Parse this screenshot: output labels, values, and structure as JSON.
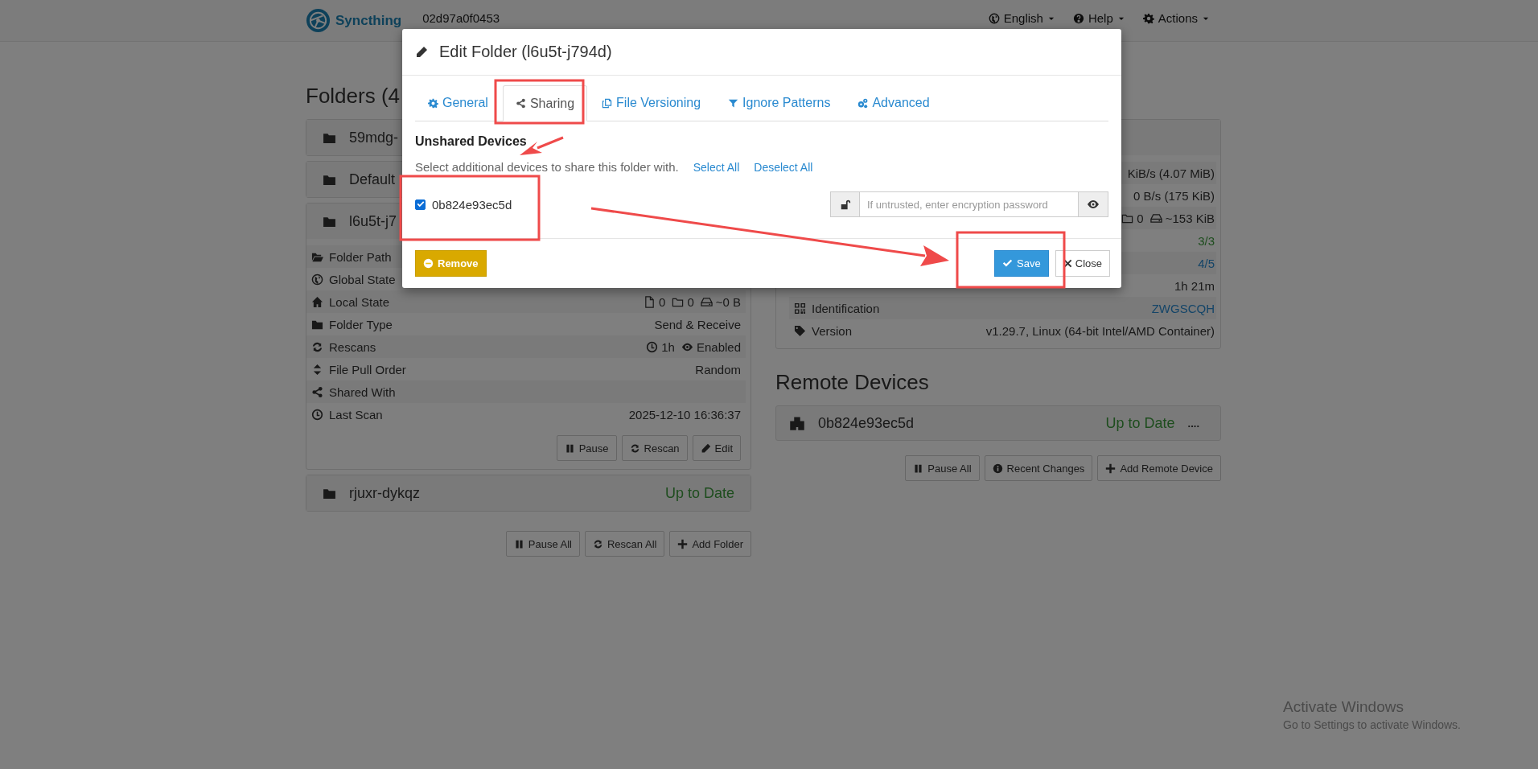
{
  "navbar": {
    "brand": "Syncthing",
    "device_name": "02d97a0f0453",
    "menus": [
      {
        "label": "English"
      },
      {
        "label": "Help"
      },
      {
        "label": "Actions"
      }
    ]
  },
  "folders": {
    "heading": "Folders (4",
    "items": [
      {
        "name": "59mdg-",
        "expanded": false
      },
      {
        "name": "Default",
        "expanded": false
      },
      {
        "name": "l6u5t-j7",
        "expanded": true,
        "details": [
          {
            "label": "Folder Path"
          },
          {
            "label": "Global State"
          },
          {
            "label": "Local State",
            "kind": "counts",
            "values": [
              "0",
              "0",
              "~0 B"
            ]
          },
          {
            "label": "Folder Type",
            "kind": "text",
            "value": "Send & Receive"
          },
          {
            "label": "Rescans",
            "kind": "rescans",
            "values": [
              "1h",
              "Enabled"
            ]
          },
          {
            "label": "File Pull Order",
            "kind": "text",
            "value": "Random"
          },
          {
            "label": "Shared With"
          },
          {
            "label": "Last Scan",
            "kind": "text",
            "value": "2025-12-10 16:36:37"
          }
        ],
        "actions": [
          "Pause",
          "Rescan",
          "Edit"
        ]
      },
      {
        "name": "rjuxr-dykqz",
        "expanded": false,
        "status": "Up to Date"
      }
    ],
    "actions": [
      "Pause All",
      "Rescan All",
      "Add Folder"
    ]
  },
  "this_device": {
    "rows": [
      {
        "kind": "text",
        "value": "KiB/s (4.07 MiB)"
      },
      {
        "kind": "text",
        "value": "0 B/s (175 KiB)"
      },
      {
        "kind": "counts",
        "values": [
          "0",
          "~153 KiB"
        ]
      },
      {
        "kind": "success",
        "value": "3/3"
      },
      {
        "kind": "link",
        "value": "4/5"
      },
      {
        "kind": "text",
        "value": "1h 21m"
      },
      {
        "kind": "link",
        "label": "Identification",
        "value": "ZWGSCQH"
      },
      {
        "kind": "text",
        "label": "Version",
        "value": "v1.29.7, Linux (64-bit Intel/AMD Container)"
      }
    ]
  },
  "remote_devices": {
    "heading": "Remote Devices",
    "items": [
      {
        "name": "0b824e93ec5d",
        "status": "Up to Date",
        "extra": "...."
      }
    ],
    "actions": [
      "Pause All",
      "Recent Changes",
      "Add Remote Device"
    ]
  },
  "modal": {
    "title": "Edit Folder (l6u5t-j794d)",
    "tabs": [
      {
        "label": "General",
        "selected": false
      },
      {
        "label": "Sharing",
        "selected": true
      },
      {
        "label": "File Versioning",
        "selected": false
      },
      {
        "label": "Ignore Patterns",
        "selected": false
      },
      {
        "label": "Advanced",
        "selected": false
      }
    ],
    "section_heading": "Unshared Devices",
    "description": "Select additional devices to share this folder with.",
    "select_all": "Select All",
    "deselect_all": "Deselect All",
    "devices": [
      {
        "name": "0b824e93ec5d",
        "checked": true,
        "password_placeholder": "If untrusted, enter encryption password"
      }
    ],
    "remove": "Remove",
    "save": "Save",
    "close": "Close"
  },
  "watermark": {
    "title": "Activate Windows",
    "subtitle": "Go to Settings to activate Windows."
  }
}
